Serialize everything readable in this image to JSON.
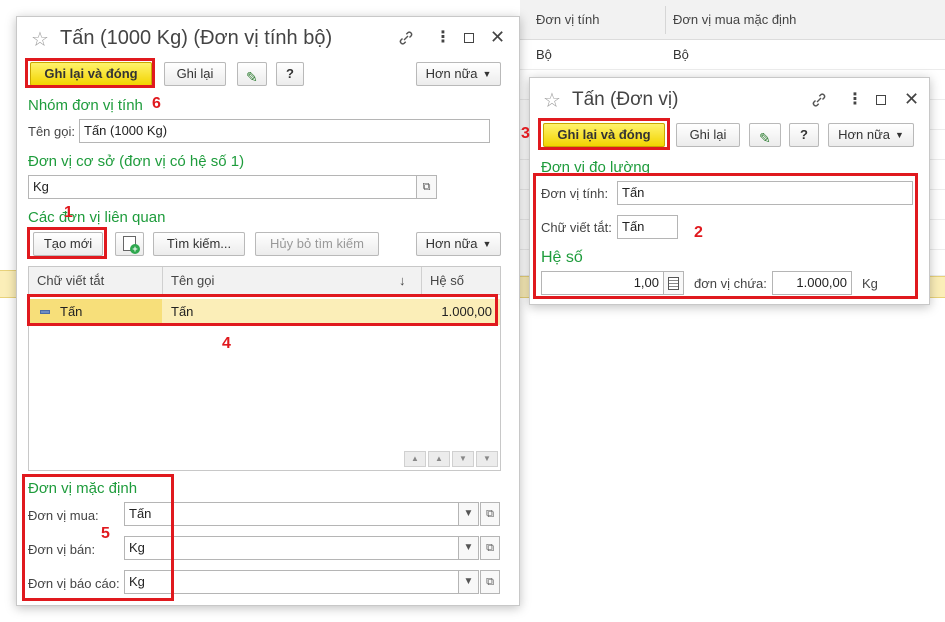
{
  "background": {
    "columns": [
      "Đơn vị tính",
      "Đơn vị mua mặc định"
    ],
    "row": [
      "Bộ",
      "Bộ"
    ]
  },
  "left_window": {
    "title": "Tấn (1000 Kg) (Đơn vị tính bộ)",
    "toolbar": {
      "save_close": "Ghi lại và đóng",
      "save": "Ghi lại",
      "help": "?",
      "more": "Hơn nữa"
    },
    "group_section": {
      "heading": "Nhóm đơn vị tính",
      "name_label": "Tên gọi:",
      "name_value": "Tấn (1000 Kg)"
    },
    "base_section": {
      "heading": "Đơn vị cơ sở (đơn vị có hệ số 1)",
      "value": "Kg"
    },
    "related_section": {
      "heading": "Các đơn vị liên quan",
      "create": "Tạo mới",
      "search": "Tìm kiếm...",
      "cancel_search": "Hủy bỏ tìm kiếm",
      "more": "Hơn nữa",
      "columns": [
        "Chữ viết tắt",
        "Tên gọi",
        "↓",
        "Hệ số"
      ],
      "rows": [
        {
          "abbr": "Tấn",
          "name": "Tấn",
          "factor": "1.000,00"
        }
      ]
    },
    "default_section": {
      "heading": "Đơn vị mặc định",
      "buy_label": "Đơn vị mua:",
      "buy_value": "Tấn",
      "sell_label": "Đơn vị bán:",
      "sell_value": "Kg",
      "report_label": "Đơn vị báo cáo:",
      "report_value": "Kg"
    }
  },
  "right_window": {
    "title": "Tấn (Đơn vị)",
    "toolbar": {
      "save_close": "Ghi lại và đóng",
      "save": "Ghi lại",
      "help": "?",
      "more": "Hơn nữa"
    },
    "measure_section": {
      "heading": "Đơn vị đo lường",
      "unit_label": "Đơn vị tính:",
      "unit_value": "Tấn",
      "abbr_label": "Chữ viết tắt:",
      "abbr_value": "Tấn"
    },
    "factor_section": {
      "heading": "Hệ số",
      "factor_value": "1,00",
      "contains_label": "đơn vị chứa:",
      "contains_value": "1.000,00",
      "unit": "Kg"
    }
  },
  "annotations": [
    "1",
    "2",
    "3",
    "4",
    "5",
    "6"
  ],
  "colors": {
    "accent_green": "#1e9c3c",
    "annotation_red": "#e0191e",
    "primary_button": "#f2d400",
    "row_highlight": "#fbeeb8"
  }
}
